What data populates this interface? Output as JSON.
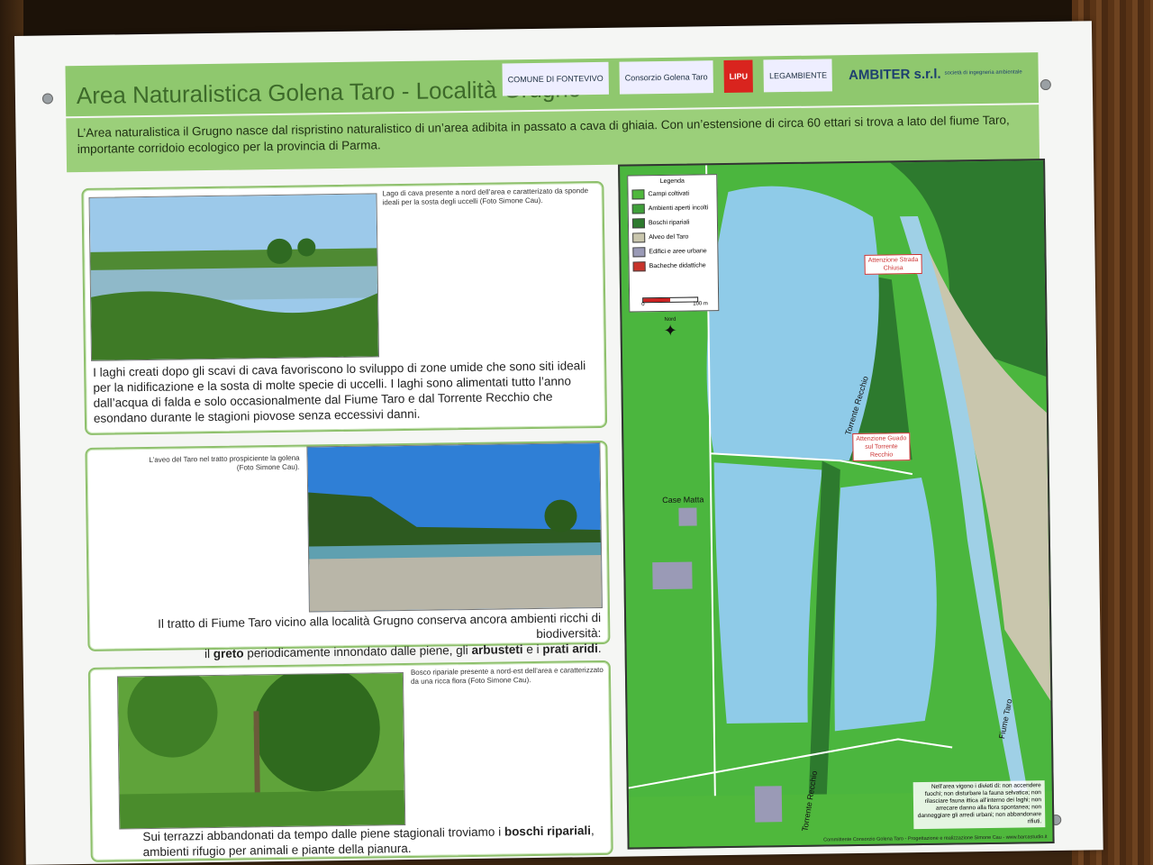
{
  "header": {
    "title": "Area Naturalistica Golena Taro - Località Grugno",
    "logos": [
      "COMUNE DI FONTEVIVO",
      "Consorzio Golena Taro",
      "LIPU",
      "LEGAMBIENTE",
      "AMBITER s.r.l.",
      "società di ingegneria ambientale"
    ]
  },
  "intro": "L’Area naturalistica il Grugno nasce dal rispristino naturalistico di un’area adibita in passato a cava di ghiaia. Con un’estensione di circa 60 ettari si trova a lato del fiume Taro, importante corridoio ecologico per la provincia di Parma.",
  "panels": [
    {
      "caption": "Lago di cava presente a nord dell’area e caratterizato da sponde ideali per la sosta degli uccelli (Foto Simone Cau).",
      "text": "I laghi creati dopo gli scavi di cava favoriscono lo sviluppo di zone umide che sono siti ideali per la nidificazione e la sosta di molte specie di uccelli. I laghi sono alimentati tutto l’anno dall’acqua di falda e solo occasionalmente dal Fiume Taro e dal Torrente Recchio che esondano durante le stagioni piovose senza eccessivi danni."
    },
    {
      "caption": "L’aveo del Taro nel tratto prospiciente la golena (Foto Simone Cau).",
      "text_a": "Il tratto di Fiume Taro vicino alla località Grugno conserva ancora ambienti  ricchi di biodiversità:",
      "text_b1": "il ",
      "bold1": "greto",
      "text_b2": " periodicamente innondato dalle piene, gli ",
      "bold2": "arbusteti",
      "text_b3": " e i ",
      "bold3": "prati aridi",
      "text_b4": "."
    },
    {
      "caption": "Bosco ripariale presente a nord-est dell’area e caratterizzato da una ricca flora (Foto Simone Cau).",
      "text_a": "Sui terrazzi abbandonati da tempo dalle piene stagionali troviamo i ",
      "bold1": "boschi ripariali",
      "text_b": ", ambienti rifugio per animali e piante della pianura."
    }
  ],
  "map": {
    "legend_title": "Legenda",
    "legend": [
      {
        "label": "Campi coltivati",
        "color": "#4fb83c"
      },
      {
        "label": "Ambienti aperti incolti",
        "color": "#3fa03a"
      },
      {
        "label": "Boschi ripariali",
        "color": "#2d7a2e"
      },
      {
        "label": "Alveo del Taro",
        "color": "#c9c6ad"
      },
      {
        "label": "Edifici e aree urbane",
        "color": "#9a9ab6"
      },
      {
        "label": "Bacheche didattiche",
        "color": "#c8332b"
      }
    ],
    "scale_start": "0",
    "scale_end": "100 m",
    "compass": "Nord",
    "warning1": "Attenzione Strada Chiusa",
    "warning2": "Attenzione Guado sul Torrente Recchio",
    "label_case": "Case Matta",
    "label_recchio1": "Torrente Recchio",
    "label_recchio2": "Torrente Recchio",
    "label_taro": "Fiume Taro",
    "notice": "Nell’area vigono i divieti di: non accendere fuochi; non disturbare la fauna selvatica; non rilasciare fauna ittica all’interno dei laghi; non arrecare danno alla flora spontanea; non danneggiare gli arredi urbani; non abbandonare rifiuti.",
    "credit": "Committente Consorzio Golena Taro - Progettazione e realizzazione Simone Cau - www.barcastudio.it"
  },
  "colors": {
    "header": "#8fc86e",
    "title": "#3d6a2a",
    "water": "#8fcbe8",
    "river": "#9fd0e6"
  }
}
